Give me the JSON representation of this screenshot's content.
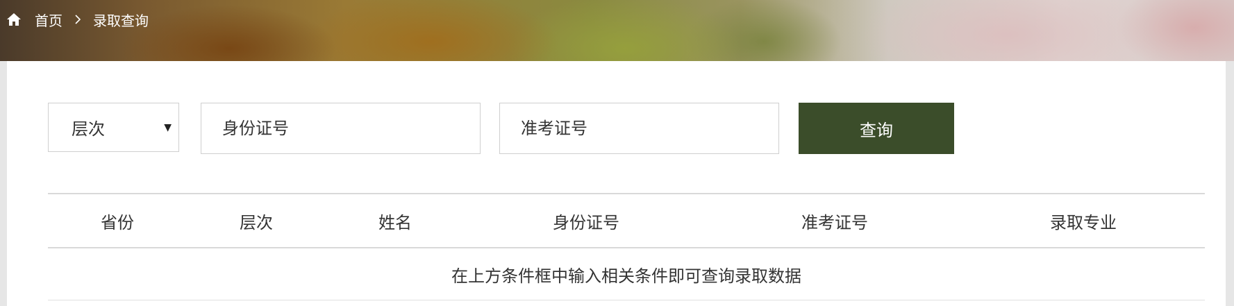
{
  "breadcrumb": {
    "home": "首页",
    "current": "录取查询"
  },
  "icons": {
    "home": "home-icon",
    "separator": "chevron-right-icon",
    "select_arrow": "caret-down-icon"
  },
  "search": {
    "level_select_value": "层次",
    "id_placeholder": "身份证号",
    "exam_placeholder": "准考证号",
    "query_label": "查询"
  },
  "table": {
    "headers": [
      "省份",
      "层次",
      "姓名",
      "身份证号",
      "准考证号",
      "录取专业"
    ],
    "empty_message": "在上方条件框中输入相关条件即可查询录取数据"
  },
  "colors": {
    "button_bg": "#3b4d2a",
    "button_text": "#ffffff",
    "text": "#333333",
    "border": "#cfcfcf"
  }
}
